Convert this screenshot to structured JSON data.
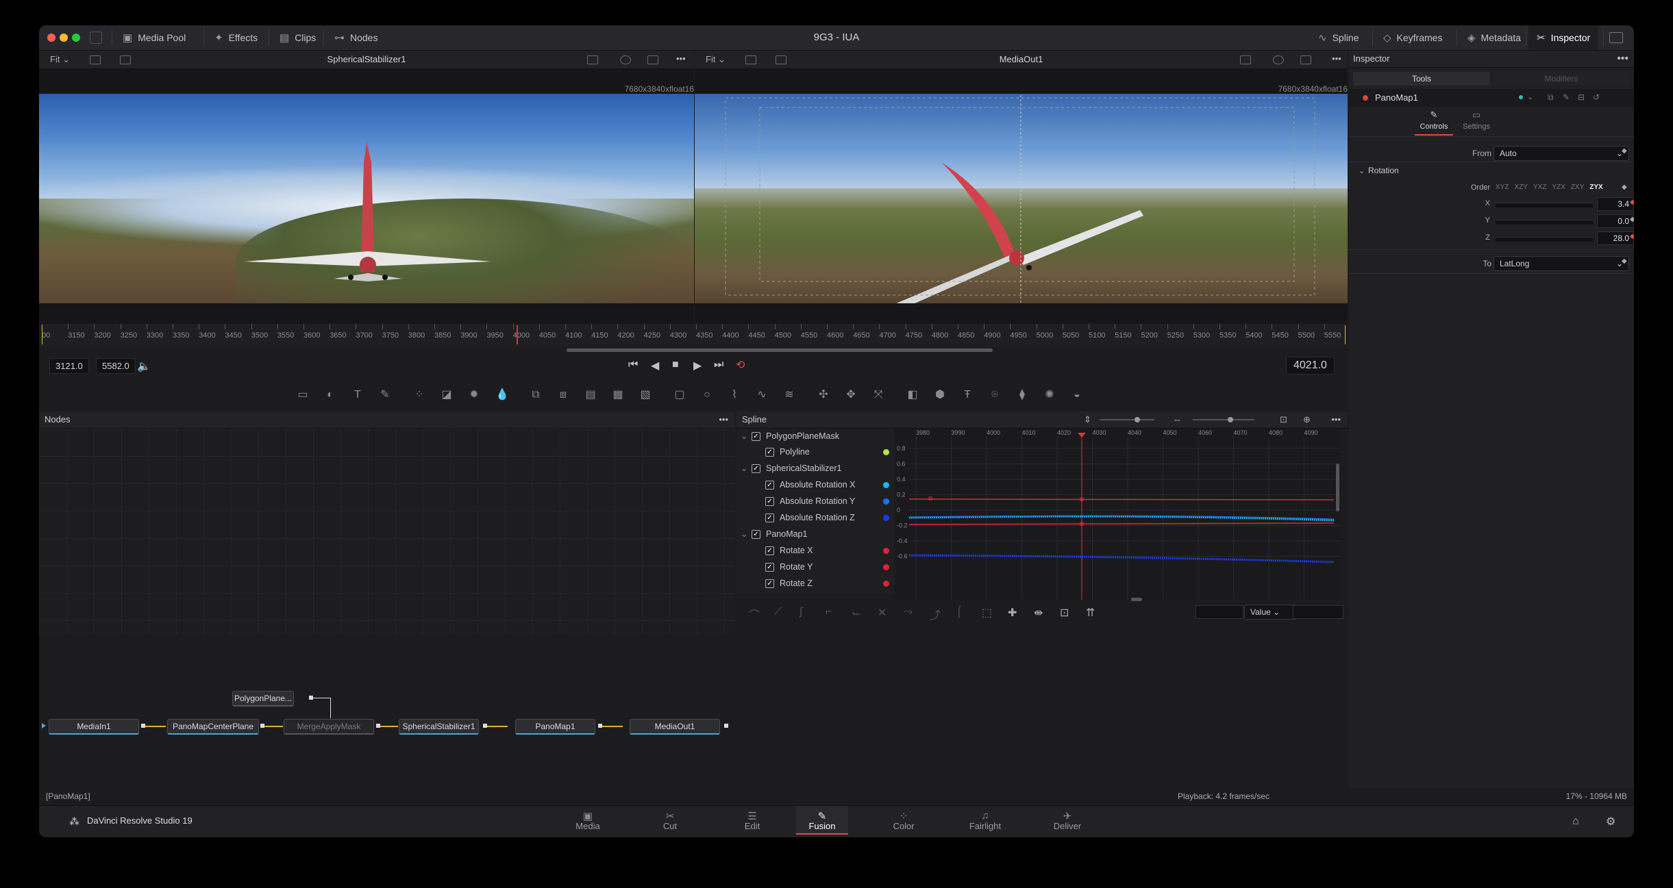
{
  "window": {
    "title": "9G3 - IUA"
  },
  "toolbar": {
    "left": [
      {
        "label": "Media Pool"
      },
      {
        "label": "Effects"
      },
      {
        "label": "Clips"
      },
      {
        "label": "Nodes"
      }
    ],
    "right": [
      {
        "label": "Spline"
      },
      {
        "label": "Keyframes"
      },
      {
        "label": "Metadata"
      },
      {
        "label": "Inspector"
      }
    ]
  },
  "viewer_left": {
    "fit": "Fit",
    "title": "SphericalStabilizer1",
    "resolution": "7680x3840xfloat16"
  },
  "viewer_right": {
    "fit": "Fit",
    "title": "MediaOut1",
    "resolution": "7680x3840xfloat16"
  },
  "ruler": {
    "ticks": [
      "00",
      "3150",
      "3200",
      "3250",
      "3300",
      "3350",
      "3400",
      "3450",
      "3500",
      "3550",
      "3600",
      "3650",
      "3700",
      "3750",
      "3800",
      "3850",
      "3900",
      "3950",
      "4000",
      "4050",
      "4100",
      "4150",
      "4200",
      "4250",
      "4300",
      "4350",
      "4400",
      "4450",
      "4500",
      "4550",
      "4600",
      "4650",
      "4700",
      "4750",
      "4800",
      "4850",
      "4900",
      "4950",
      "5000",
      "5050",
      "5100",
      "5150",
      "5200",
      "5250",
      "5300",
      "5350",
      "5400",
      "5450",
      "5500",
      "5550"
    ]
  },
  "transport": {
    "start": "3121.0",
    "end": "5582.0",
    "current": "4021.0"
  },
  "nodes_panel": {
    "title": "Nodes",
    "nodes": [
      {
        "label": "MediaIn1"
      },
      {
        "label": "PanoMapCenterPlane"
      },
      {
        "label": "MergeApplyMask"
      },
      {
        "label": "SphericalStabilizer1"
      },
      {
        "label": "PanoMap1"
      },
      {
        "label": "MediaOut1"
      },
      {
        "label": "PolygonPlane..."
      }
    ]
  },
  "spline_panel": {
    "title": "Spline",
    "items": [
      {
        "label": "PolygonPlaneMask",
        "color": ""
      },
      {
        "label": "Polyline",
        "color": "#b4e34a"
      },
      {
        "label": "SphericalStabilizer1",
        "color": ""
      },
      {
        "label": "Absolute Rotation X",
        "color": "#1eb6f0"
      },
      {
        "label": "Absolute Rotation Y",
        "color": "#1a74f0"
      },
      {
        "label": "Absolute Rotation Z",
        "color": "#1a3af0"
      },
      {
        "label": "PanoMap1",
        "color": ""
      },
      {
        "label": "Rotate X",
        "color": "#e0203a"
      },
      {
        "label": "Rotate Y",
        "color": "#e0203a"
      },
      {
        "label": "Rotate Z",
        "color": "#e0203a"
      }
    ],
    "x_ticks": [
      "3980",
      "3990",
      "4000",
      "4010",
      "4020",
      "4030",
      "4040",
      "4050",
      "4060",
      "4070",
      "4080",
      "4090"
    ],
    "y_ticks": [
      "0.8",
      "0.6",
      "0.4",
      "0.2",
      "0",
      "-0.2",
      "-0.4",
      "-0.6"
    ],
    "value_dropdown": "Value"
  },
  "inspector": {
    "title": "Inspector",
    "tabs": [
      "Tools",
      "Modifiers"
    ],
    "tool_name": "PanoMap1",
    "subtabs": [
      "Controls",
      "Settings"
    ],
    "from_label": "From",
    "from_value": "Auto",
    "section": "Rotation",
    "order_label": "Order",
    "orders": [
      "XYZ",
      "XZY",
      "YXZ",
      "YZX",
      "ZXY",
      "ZYX"
    ],
    "x_label": "X",
    "x_value": "3.4",
    "y_label": "Y",
    "y_value": "0.0",
    "z_label": "Z",
    "z_value": "28.0",
    "to_label": "To",
    "to_value": "LatLong"
  },
  "status": {
    "left": "[PanoMap1]",
    "playback": "Playback: 4.2 frames/sec",
    "memory": "17% - 10964 MB"
  },
  "pages": {
    "app_name": "DaVinci Resolve Studio 19",
    "items": [
      {
        "label": "Media"
      },
      {
        "label": "Cut"
      },
      {
        "label": "Edit"
      },
      {
        "label": "Fusion"
      },
      {
        "label": "Color"
      },
      {
        "label": "Fairlight"
      },
      {
        "label": "Deliver"
      }
    ]
  }
}
